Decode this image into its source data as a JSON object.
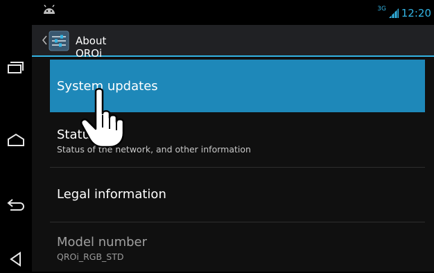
{
  "status_bar": {
    "network_type": "3G",
    "time": "12:20",
    "accent": "#33b5e5"
  },
  "action_bar": {
    "title": "About QROi",
    "icon": "settings-sliders-icon"
  },
  "settings": {
    "items": [
      {
        "title": "System updates",
        "summary": "",
        "state": "pressed"
      },
      {
        "title": "Status",
        "summary": "Status of the network, and other information",
        "state": "normal"
      },
      {
        "title": "Legal information",
        "summary": "",
        "state": "normal"
      },
      {
        "title": "Model number",
        "summary": "QROi_RGB_STD",
        "state": "disabled"
      }
    ]
  },
  "nav_bar": {
    "buttons": [
      "recent-apps-icon",
      "home-icon",
      "back-icon",
      "menu-icon"
    ]
  },
  "colors": {
    "selection": "#1e88b9",
    "background": "#101010",
    "action_bar": "#202124"
  }
}
